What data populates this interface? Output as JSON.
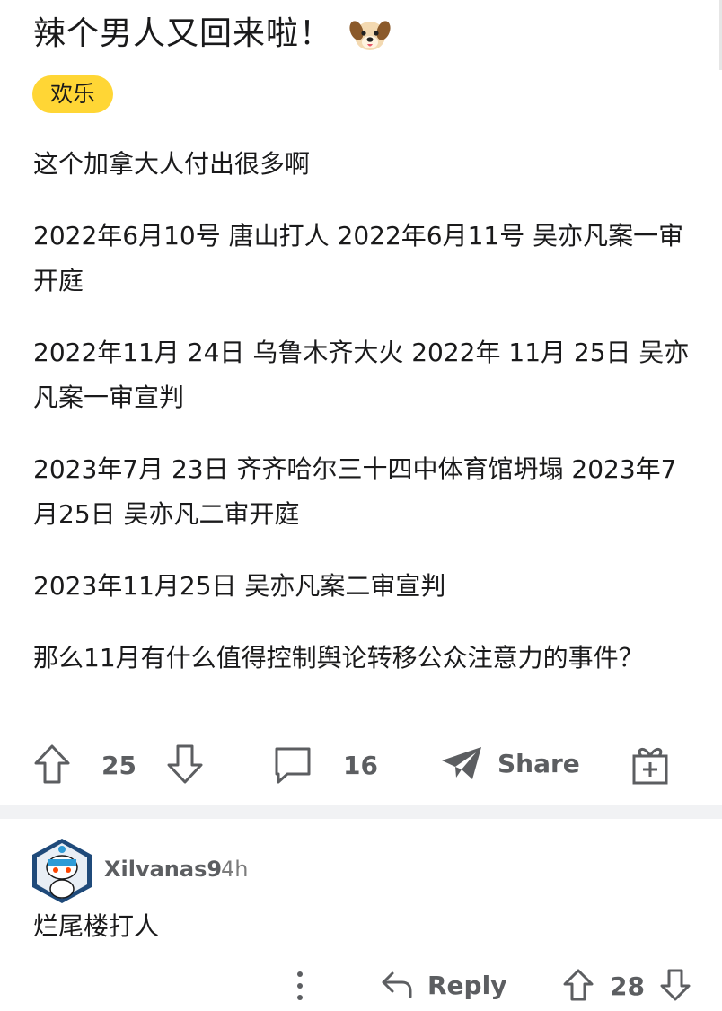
{
  "post": {
    "title": "辣个男人又回来啦！",
    "title_emoji_icon": "dog-face-icon",
    "flair": "欢乐",
    "paragraphs": [
      "这个加拿大人付出很多啊",
      "2022年6月10号 唐山打人 2022年6月11号 吴亦凡案一审开庭",
      "2022年11月 24日 乌鲁木齐大火 2022年 11月 25日 吴亦凡案一审宣判",
      "2023年7月 23日 齐齐哈尔三十四中体育馆坍塌 2023年7月25日 吴亦凡二审开庭",
      "2023年11月25日 吴亦凡案二审宣判",
      "那么11月有什么值得控制舆论转移公众注意力的事件？"
    ],
    "vote_count": "25",
    "comment_count": "16",
    "share_label": "Share",
    "icons": [
      "upvote-icon",
      "downvote-icon",
      "comment-icon",
      "share-icon",
      "gift-award-icon"
    ]
  },
  "comment": {
    "author": "Xilvanas9",
    "time": "4h",
    "text": "烂尾楼打人",
    "reply_label": "Reply",
    "vote_count": "28",
    "icons": [
      "avatar",
      "more-options-icon",
      "reply-icon",
      "upvote-icon",
      "downvote-icon"
    ]
  },
  "colors": {
    "flair_bg": "#ffd635",
    "text": "#1a1a1b",
    "meta": "#5c5e61",
    "divider": "#f1f2f4"
  }
}
